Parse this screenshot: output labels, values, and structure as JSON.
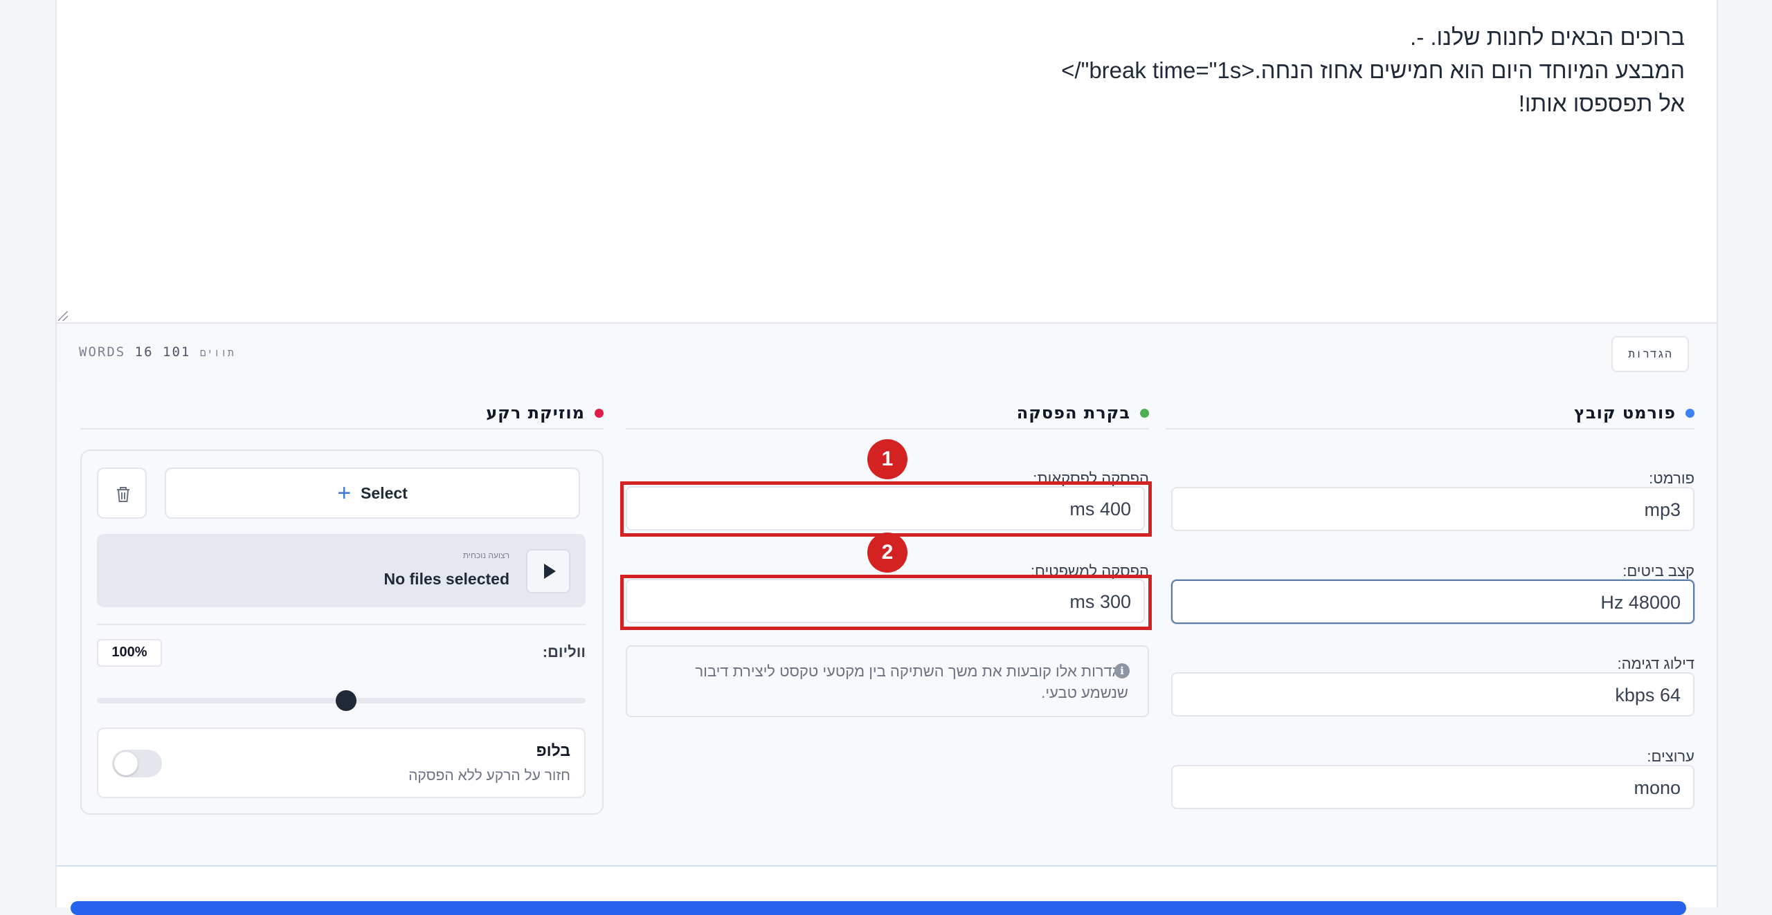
{
  "editor": {
    "lines": [
      "ברוכים הבאים לחנות שלנו. -.",
      "המבצע המיוחד היום הוא חמישים אחוז הנחה.<break time=\"1s\"/>",
      "אל תפספסו אותו!"
    ]
  },
  "toolbar": {
    "words_label": "WORDS",
    "words_count": "16",
    "chars_label": "תווים",
    "chars_count": "101",
    "settings_label": "הגדרות"
  },
  "format_section": {
    "title": "פורמט קובץ",
    "dot_color": "#3b82f6",
    "format_label": "פורמט:",
    "format_value": "mp3",
    "sample_rate_label": "קצב ביטים:",
    "sample_rate_value": "48000 Hz",
    "bitrate_label": "דילוג דגימה:",
    "bitrate_value": "64 kbps",
    "channels_label": "ערוצים:",
    "channels_value": "mono"
  },
  "pause_section": {
    "title": "בקרת הפסקה",
    "dot_color": "#4caf50",
    "paragraph_label": "הפסקה לפסקאות:",
    "paragraph_value": "400 ms",
    "sentence_label": "הפסקה למשפטים:",
    "sentence_value": "300 ms",
    "info_text": "הגדרות אלו קובעות את משך השתיקה בין מקטעי טקסט ליצירת דיבור שנשמע טבעי.",
    "badge_1": "1",
    "badge_2": "2",
    "highlight_color": "#d42121"
  },
  "music_section": {
    "title": "מוזיקת רקע",
    "dot_color": "#e11d48",
    "select_label": "Select",
    "file_caption": "רצועה נוכחית",
    "file_name": "No files selected",
    "volume_label": "ווליום:",
    "volume_value": "100%",
    "volume_fraction": 0.51,
    "loop_title": "בלופ",
    "loop_subtitle": "חזור על הרקע ללא הפסקה",
    "loop_enabled": false
  },
  "accent_color": "#2563eb"
}
